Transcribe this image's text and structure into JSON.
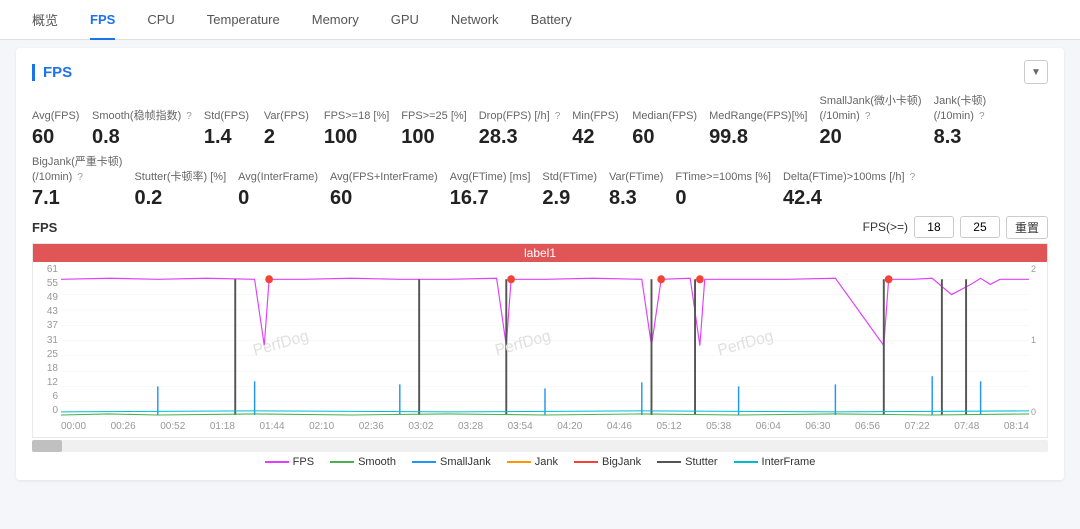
{
  "nav": {
    "items": [
      {
        "id": "overview",
        "label": "概览",
        "active": false
      },
      {
        "id": "fps",
        "label": "FPS",
        "active": true
      },
      {
        "id": "cpu",
        "label": "CPU",
        "active": false
      },
      {
        "id": "temperature",
        "label": "Temperature",
        "active": false
      },
      {
        "id": "memory",
        "label": "Memory",
        "active": false
      },
      {
        "id": "gpu",
        "label": "GPU",
        "active": false
      },
      {
        "id": "network",
        "label": "Network",
        "active": false
      },
      {
        "id": "battery",
        "label": "Battery",
        "active": false
      }
    ]
  },
  "fps_card": {
    "title": "FPS",
    "collapse_label": "▼",
    "stats_row1": [
      {
        "label": "Avg(FPS)",
        "value": "60",
        "has_icon": false
      },
      {
        "label": "Smooth(稳帧指数)",
        "value": "0.8",
        "has_icon": true
      },
      {
        "label": "Std(FPS)",
        "value": "1.4",
        "has_icon": false
      },
      {
        "label": "Var(FPS)",
        "value": "2",
        "has_icon": false
      },
      {
        "label": "FPS>=18 [%]",
        "value": "100",
        "has_icon": false
      },
      {
        "label": "FPS>=25 [%]",
        "value": "100",
        "has_icon": false
      },
      {
        "label": "Drop(FPS) [/h]",
        "value": "28.3",
        "has_icon": true
      },
      {
        "label": "Min(FPS)",
        "value": "42",
        "has_icon": false
      },
      {
        "label": "Median(FPS)",
        "value": "60",
        "has_icon": false
      },
      {
        "label": "MedRange(FPS)[%]",
        "value": "99.8",
        "has_icon": false
      },
      {
        "label": "SmallJank(微小卡顿)(/10min)",
        "value": "20",
        "has_icon": true
      },
      {
        "label": "Jank(卡顿)(/10min)",
        "value": "8.3",
        "has_icon": true
      }
    ],
    "stats_row2": [
      {
        "label": "BigJank(严重卡顿)(/10min)",
        "value": "7.1",
        "has_icon": true
      },
      {
        "label": "Stutter(卡顿率) [%]",
        "value": "0.2",
        "has_icon": false
      },
      {
        "label": "Avg(InterFrame)",
        "value": "0",
        "has_icon": false
      },
      {
        "label": "Avg(FPS+InterFrame)",
        "value": "60",
        "has_icon": false
      },
      {
        "label": "Avg(FTime) [ms]",
        "value": "16.7",
        "has_icon": false
      },
      {
        "label": "Std(FTime)",
        "value": "2.9",
        "has_icon": false
      },
      {
        "label": "Var(FTime)",
        "value": "8.3",
        "has_icon": false
      },
      {
        "label": "FTime>=100ms [%]",
        "value": "0",
        "has_icon": false
      },
      {
        "label": "Delta(FTime)>100ms [/h]",
        "value": "42.4",
        "has_icon": true
      }
    ],
    "chart": {
      "title": "FPS",
      "fps_ge_label": "FPS(>=)",
      "fps_value1": "18",
      "fps_value2": "25",
      "reset_label": "重置",
      "label_bar_text": "label1",
      "y_axis": [
        "61",
        "55",
        "49",
        "43",
        "37",
        "31",
        "25",
        "18",
        "12",
        "6",
        "0"
      ],
      "y_axis_right": [
        "2",
        "1",
        "0"
      ],
      "x_axis": [
        "00:00",
        "00:26",
        "00:52",
        "01:18",
        "01:44",
        "02:10",
        "02:36",
        "03:02",
        "03:28",
        "03:54",
        "04:20",
        "04:46",
        "05:12",
        "05:38",
        "06:04",
        "06:30",
        "06:56",
        "07:22",
        "07:48",
        "08:14"
      ],
      "watermark": "PerfDog",
      "legend": [
        {
          "label": "FPS",
          "color": "#e040fb",
          "dashed": false
        },
        {
          "label": "Smooth",
          "color": "#4caf50",
          "dashed": false
        },
        {
          "label": "SmallJank",
          "color": "#2196f3",
          "dashed": false
        },
        {
          "label": "Jank",
          "color": "#ff9800",
          "dashed": false
        },
        {
          "label": "BigJank",
          "color": "#f44336",
          "dashed": false
        },
        {
          "label": "Stutter",
          "color": "#555555",
          "dashed": false
        },
        {
          "label": "InterFrame",
          "color": "#00bcd4",
          "dashed": false
        }
      ]
    }
  }
}
